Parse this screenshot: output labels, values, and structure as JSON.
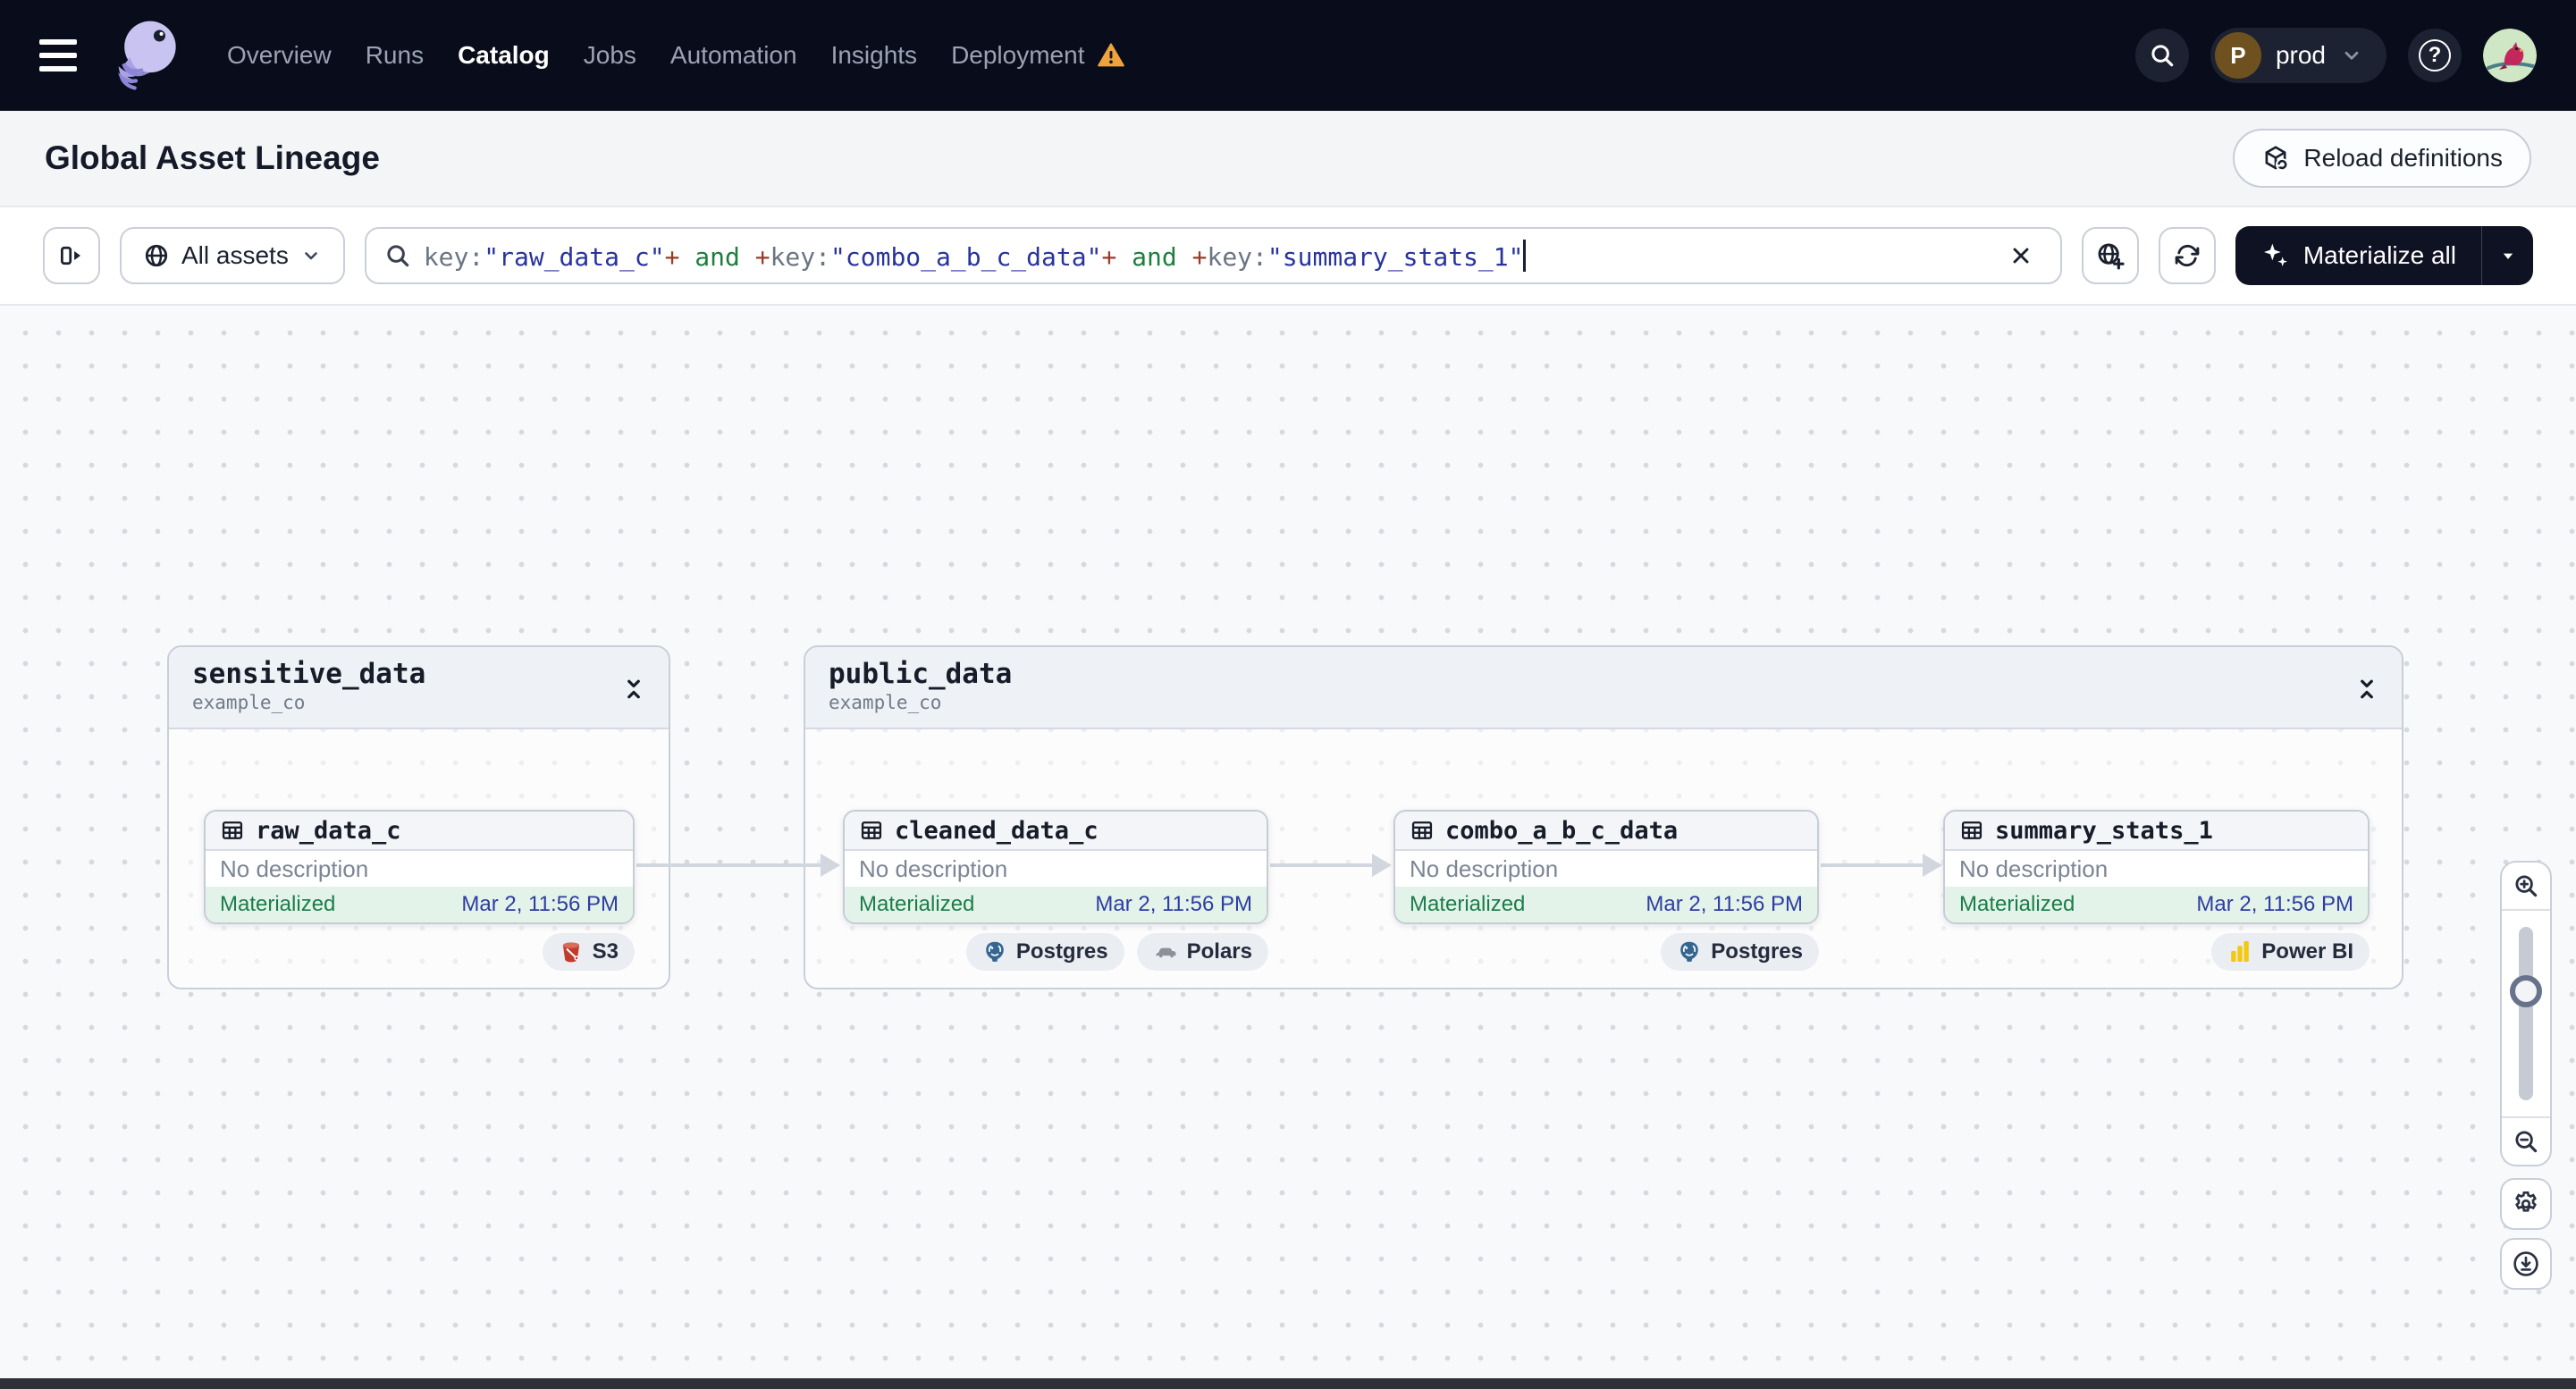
{
  "nav": {
    "links": [
      {
        "label": "Overview"
      },
      {
        "label": "Runs"
      },
      {
        "label": "Catalog"
      },
      {
        "label": "Jobs"
      },
      {
        "label": "Automation"
      },
      {
        "label": "Insights"
      },
      {
        "label": "Deployment"
      }
    ],
    "active": "Catalog",
    "env": {
      "initial": "P",
      "name": "prod"
    }
  },
  "header": {
    "title": "Global Asset Lineage",
    "reload_label": "Reload definitions"
  },
  "toolbar": {
    "scope_label": "All assets",
    "materialize_label": "Materialize all",
    "query": {
      "full": "key:\"raw_data_c\"+ and +key:\"combo_a_b_c_data\"+ and +key:\"summary_stats_1\"",
      "parts": [
        {
          "text": "key:",
          "type": "key"
        },
        {
          "text": "\"raw_data_c\"",
          "type": "value"
        },
        {
          "text": "+",
          "type": "op"
        },
        {
          "text": " and ",
          "type": "and"
        },
        {
          "text": "+",
          "type": "op"
        },
        {
          "text": "key:",
          "type": "key"
        },
        {
          "text": "\"combo_a_b_c_data\"",
          "type": "value"
        },
        {
          "text": "+",
          "type": "op"
        },
        {
          "text": " and ",
          "type": "and"
        },
        {
          "text": "+",
          "type": "op"
        },
        {
          "text": "key:",
          "type": "key"
        },
        {
          "text": "\"summary_stats_1\"",
          "type": "value"
        }
      ]
    }
  },
  "graph": {
    "groups": [
      {
        "name": "sensitive_data",
        "repo": "example_co",
        "nodes": [
          {
            "name": "raw_data_c",
            "description": "No description",
            "status": "Materialized",
            "timestamp": "Mar 2, 11:56 PM",
            "tags": [
              {
                "label": "S3",
                "icon": "s3-icon"
              }
            ]
          }
        ]
      },
      {
        "name": "public_data",
        "repo": "example_co",
        "nodes": [
          {
            "name": "cleaned_data_c",
            "description": "No description",
            "status": "Materialized",
            "timestamp": "Mar 2, 11:56 PM",
            "tags": [
              {
                "label": "Postgres",
                "icon": "postgres-icon"
              },
              {
                "label": "Polars",
                "icon": "polars-icon"
              }
            ]
          },
          {
            "name": "combo_a_b_c_data",
            "description": "No description",
            "status": "Materialized",
            "timestamp": "Mar 2, 11:56 PM",
            "tags": [
              {
                "label": "Postgres",
                "icon": "postgres-icon"
              }
            ]
          },
          {
            "name": "summary_stats_1",
            "description": "No description",
            "status": "Materialized",
            "timestamp": "Mar 2, 11:56 PM",
            "tags": [
              {
                "label": "Power BI",
                "icon": "powerbi-icon"
              }
            ]
          }
        ]
      }
    ]
  },
  "colors": {
    "nav_bg": "#090c1a",
    "status_green": "#1c7d4a",
    "status_green_bg": "#e3f3e9",
    "timestamp_blue": "#2e3da0",
    "warning_orange": "#efa33d",
    "query_value_blue": "#28339e",
    "query_op_red": "#9a3b28",
    "query_and_green": "#1e7e3e"
  }
}
